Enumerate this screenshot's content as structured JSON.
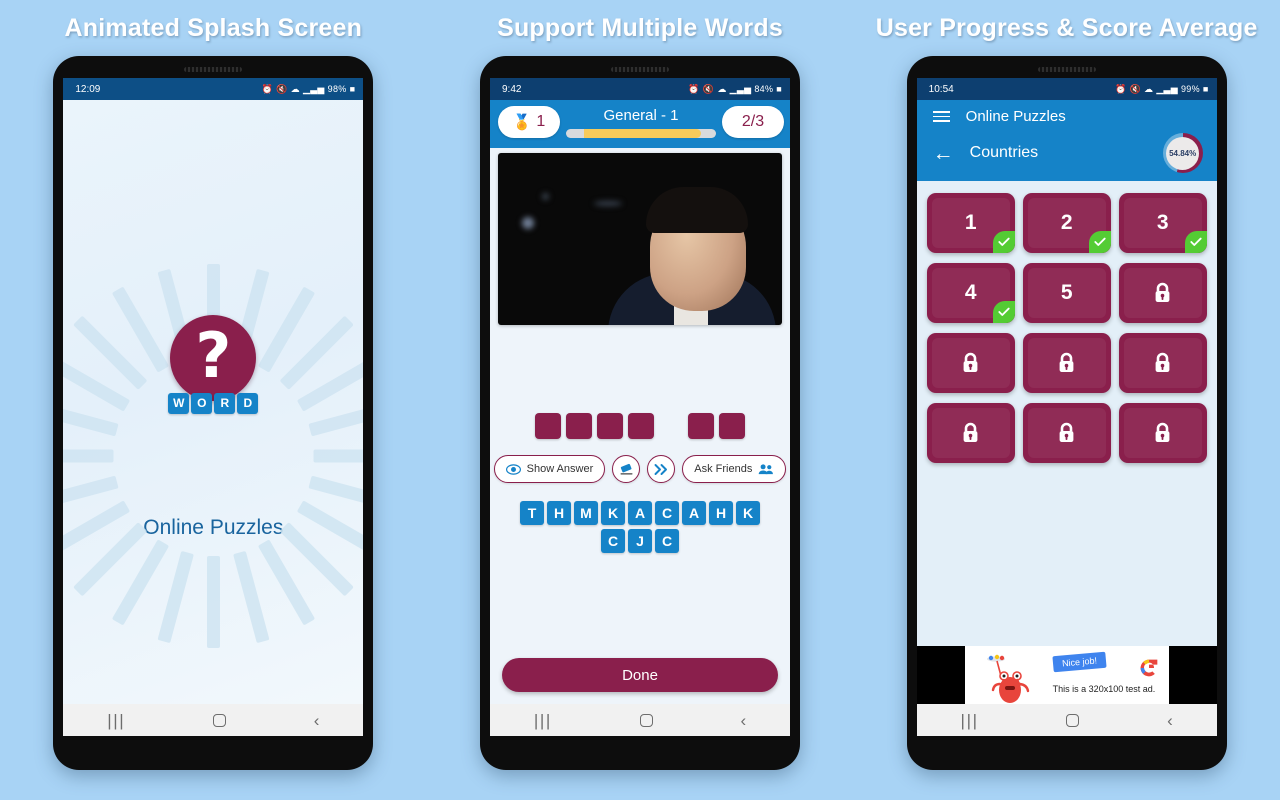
{
  "panels": [
    {
      "title": "Animated Splash Screen"
    },
    {
      "title": "Support Multiple Words"
    },
    {
      "title": "User Progress & Score Average"
    }
  ],
  "colors": {
    "background": "#a8d3f5",
    "brand_maroon": "#8a1f4c",
    "brand_blue": "#1583c8",
    "status_bar": "#0d4f86",
    "check_green": "#54cc34",
    "progress_gold": "#f6cb5b"
  },
  "splash": {
    "status": {
      "time": "12:09",
      "battery": "98%",
      "icons": [
        "alarm-icon",
        "mute-icon",
        "wifi-icon",
        "signal-icon",
        "battery-icon"
      ]
    },
    "logo": {
      "question_mark": "?",
      "word_tiles": [
        "W",
        "O",
        "R",
        "D"
      ]
    },
    "app_name": "Online Puzzles",
    "nav": {
      "recents": "|||",
      "home": "",
      "back": "‹"
    }
  },
  "game": {
    "status": {
      "time": "9:42",
      "battery": "84%"
    },
    "coins": "1",
    "level_title": "General - 1",
    "counter": "2/3",
    "progress_percent": 78,
    "answer_slots": [
      4,
      2
    ],
    "helpers": {
      "show_answer": "Show Answer",
      "ask_friends": "Ask Friends",
      "eraser": "eraser-icon",
      "skip": "skip-icon"
    },
    "letters_row1": [
      "T",
      "H",
      "M",
      "K",
      "A",
      "C",
      "A",
      "H",
      "K"
    ],
    "letters_row2": [
      "C",
      "J",
      "C"
    ],
    "done_label": "Done",
    "nav": {
      "recents": "|||",
      "home": "",
      "back": "‹"
    }
  },
  "levels": {
    "status": {
      "time": "10:54",
      "battery": "99%"
    },
    "app_title": "Online Puzzles",
    "category": "Countries",
    "score_average": "54.84%",
    "score_percent": 55,
    "cards": [
      {
        "label": "1",
        "locked": false,
        "completed": true
      },
      {
        "label": "2",
        "locked": false,
        "completed": true
      },
      {
        "label": "3",
        "locked": false,
        "completed": true
      },
      {
        "label": "4",
        "locked": false,
        "completed": true
      },
      {
        "label": "5",
        "locked": false,
        "completed": false
      },
      {
        "label": "",
        "locked": true,
        "completed": false
      },
      {
        "label": "",
        "locked": true,
        "completed": false
      },
      {
        "label": "",
        "locked": true,
        "completed": false
      },
      {
        "label": "",
        "locked": true,
        "completed": false
      },
      {
        "label": "",
        "locked": true,
        "completed": false
      },
      {
        "label": "",
        "locked": true,
        "completed": false
      },
      {
        "label": "",
        "locked": true,
        "completed": false
      }
    ],
    "ad": {
      "flag_text": "Nice job!",
      "body_text": "This is a 320x100 test ad.",
      "logo": "admob-icon"
    },
    "nav": {
      "recents": "|||",
      "home": "",
      "back": "‹"
    }
  }
}
